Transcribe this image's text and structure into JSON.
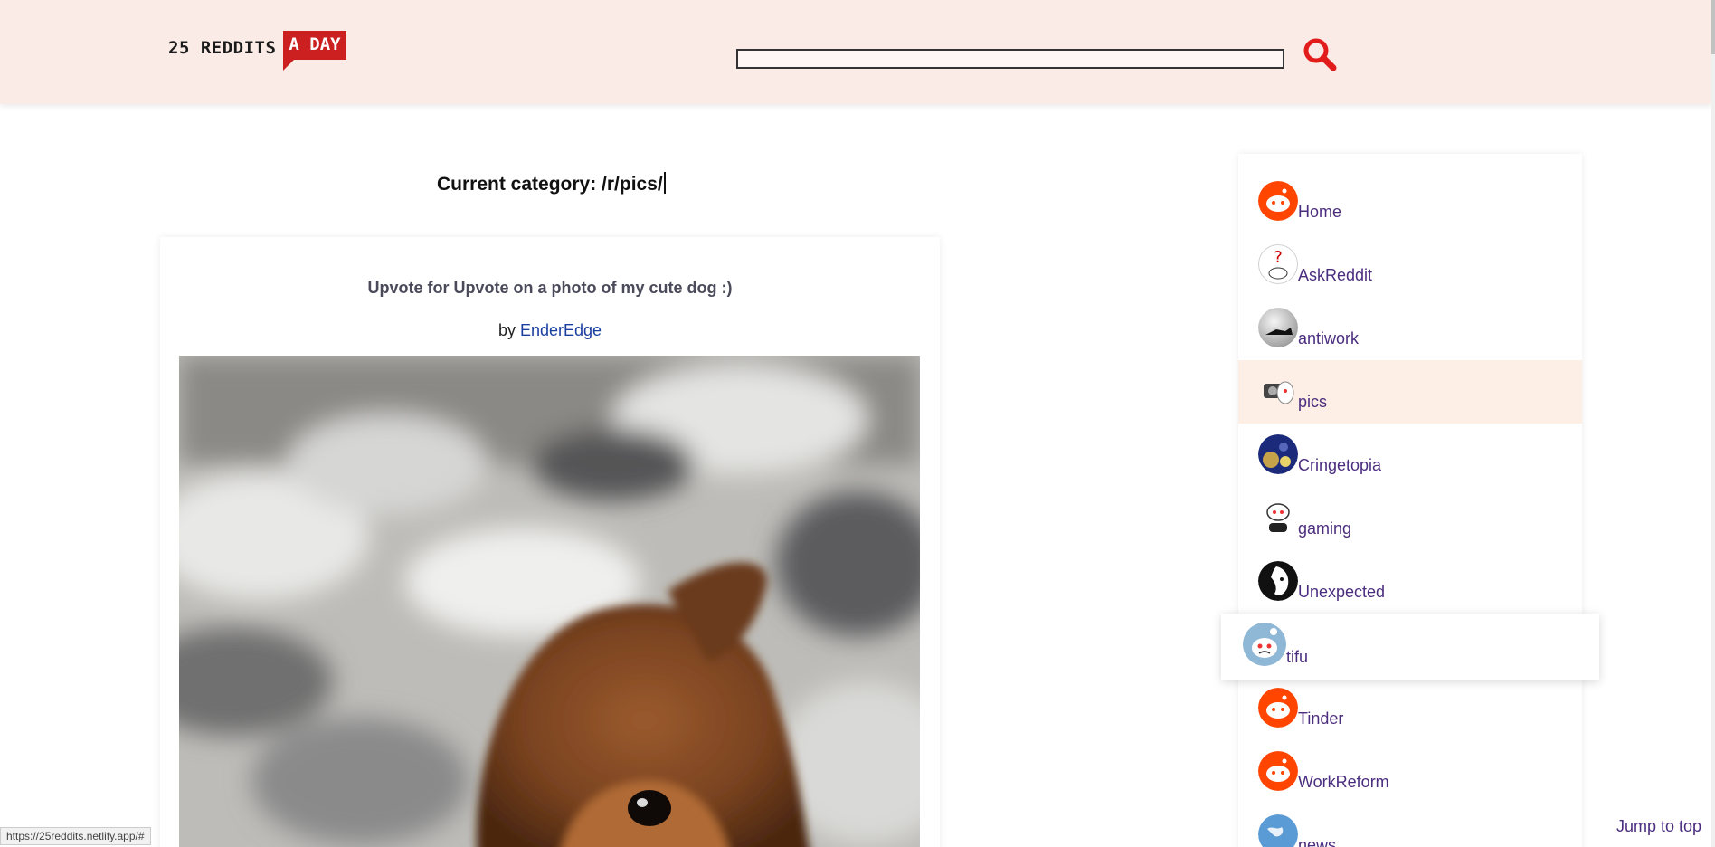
{
  "header": {
    "logo_main": "25 REDDITS",
    "logo_accent": "A DAY",
    "search_value": "",
    "search_icon": "search-icon",
    "brand_color": "#cc1f1f",
    "background_color": "#fbebe7"
  },
  "main": {
    "category_label": "Current category: /r/pics/"
  },
  "post": {
    "title": "Upvote for Upvote on a photo of my cute dog :)",
    "by_label": "by",
    "author": "EnderEdge",
    "image_icon": "dog-photo"
  },
  "sidebar": {
    "items": [
      {
        "label": "Home",
        "icon": "reddit-snoo-icon",
        "active": false
      },
      {
        "label": "AskReddit",
        "icon": "askreddit-icon",
        "active": false
      },
      {
        "label": "antiwork",
        "icon": "antiwork-icon",
        "active": false
      },
      {
        "label": "pics",
        "icon": "pics-icon",
        "active": true
      },
      {
        "label": "Cringetopia",
        "icon": "cringetopia-icon",
        "active": false
      },
      {
        "label": "gaming",
        "icon": "gaming-icon",
        "active": false
      },
      {
        "label": "Unexpected",
        "icon": "unexpected-icon",
        "active": false
      },
      {
        "label": "tifu",
        "icon": "tifu-icon",
        "active": false
      },
      {
        "label": "Tinder",
        "icon": "reddit-snoo-icon",
        "active": false
      },
      {
        "label": "WorkReform",
        "icon": "reddit-snoo-icon",
        "active": false
      },
      {
        "label": "news",
        "icon": "globe-icon",
        "active": false
      }
    ],
    "active_color": "#fdefe5",
    "link_color": "#4b2d7f"
  },
  "footer": {
    "status_url": "https://25reddits.netlify.app/#",
    "jump_to_top": "Jump to top"
  }
}
